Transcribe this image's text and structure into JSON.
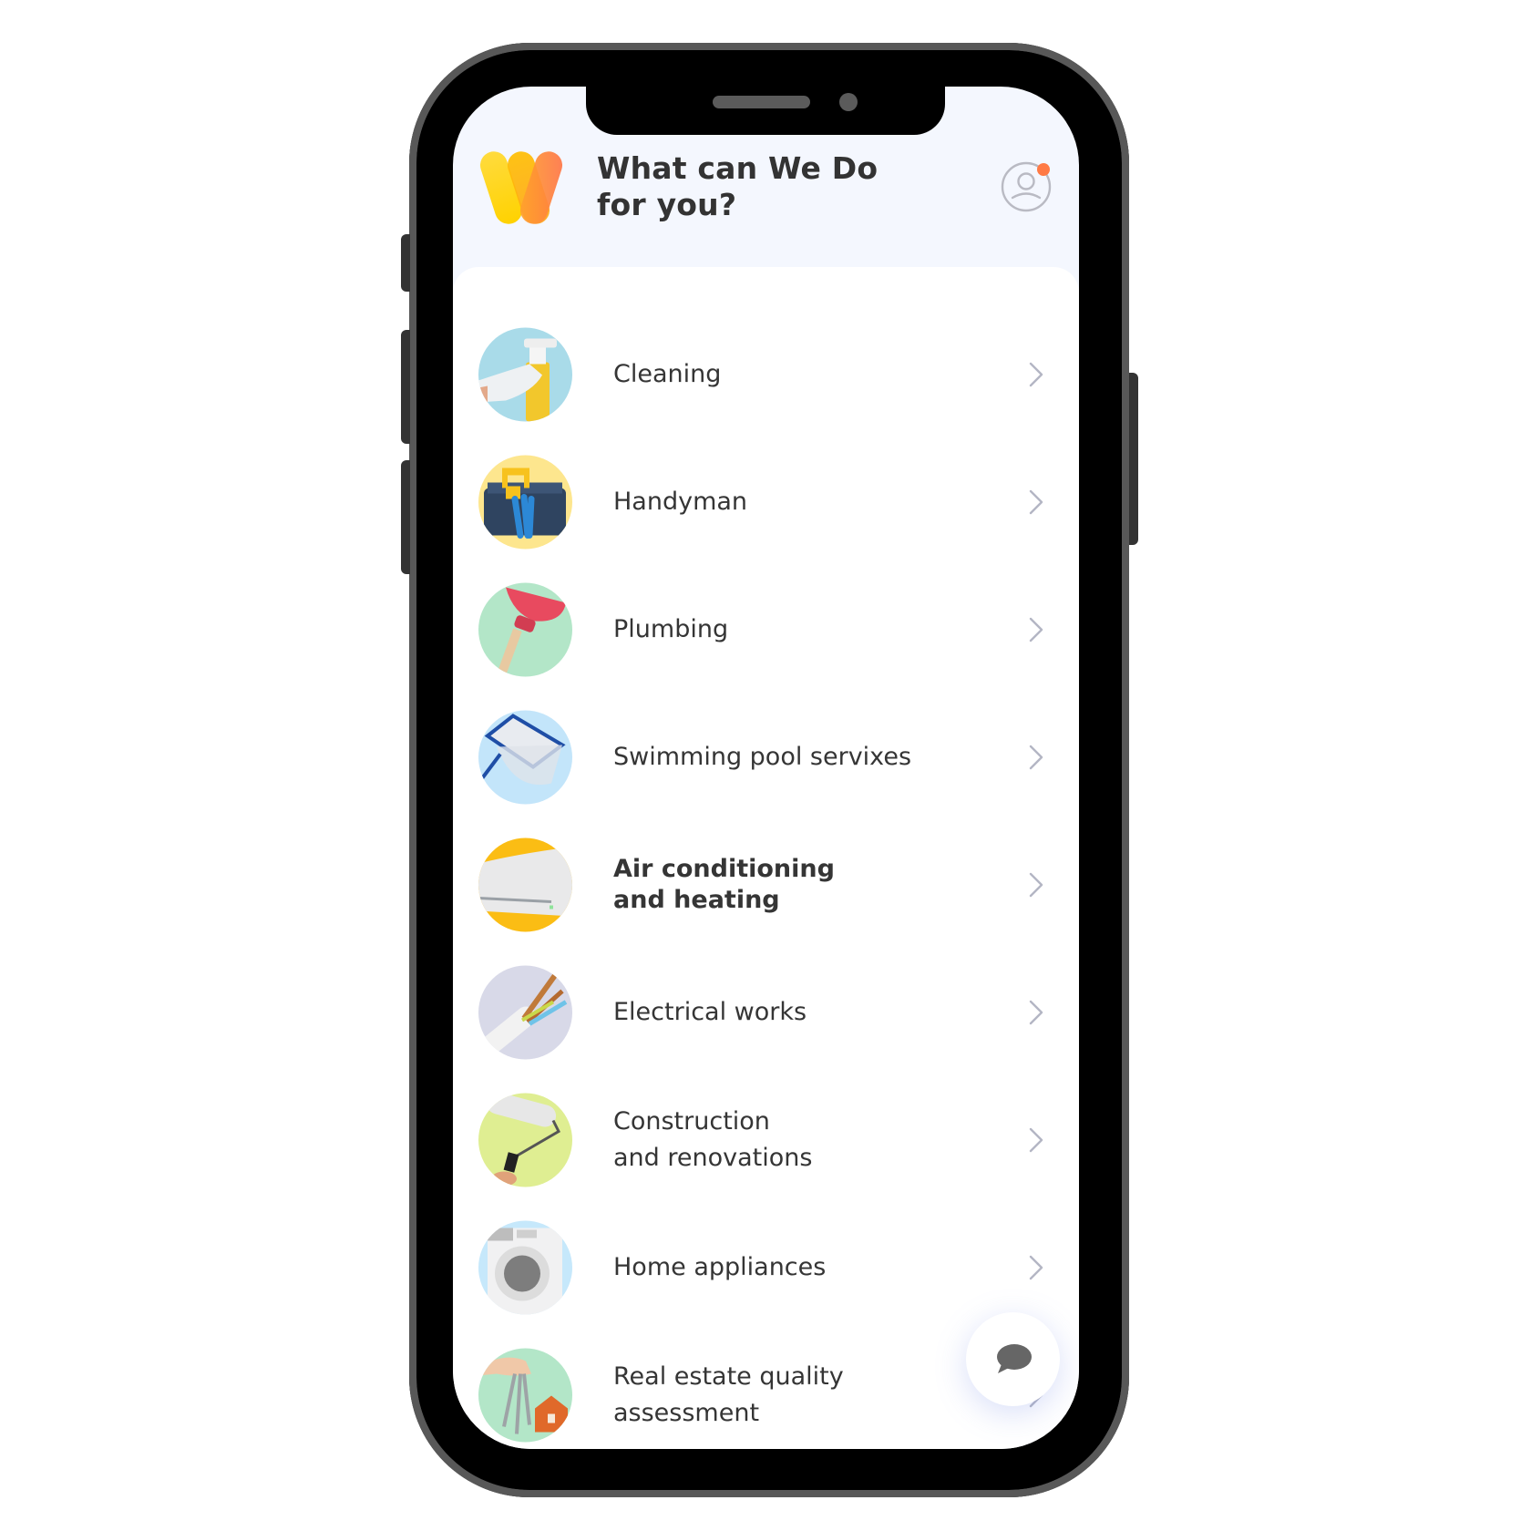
{
  "header": {
    "title_line1": "What can We Do",
    "title_line2": "for you?",
    "logo_icon": "brand-w-logo",
    "profile_icon": "user-profile-icon",
    "notification_dot_color": "#ff7a45"
  },
  "services": [
    {
      "label": "Cleaning",
      "icon": "spray-bottle-icon",
      "bg": "#a9dbe9",
      "bold": false
    },
    {
      "label": "Handyman",
      "icon": "toolbox-icon",
      "bg": "#fde68e",
      "bold": false
    },
    {
      "label": "Plumbing",
      "icon": "plunger-icon",
      "bg": "#b3e6c8",
      "bold": false
    },
    {
      "label": "Swimming pool servixes",
      "icon": "pool-net-icon",
      "bg": "#c3e5fa",
      "bold": false
    },
    {
      "label": "Air conditioning\nand heating",
      "icon": "air-conditioner-icon",
      "bg": "#fbbd14",
      "bold": true
    },
    {
      "label": "Electrical works",
      "icon": "electric-wires-icon",
      "bg": "#d8d9e8",
      "bold": false
    },
    {
      "label": "Construction\nand renovations",
      "icon": "paint-roller-icon",
      "bg": "#dfee92",
      "bold": false
    },
    {
      "label": "Home appliances",
      "icon": "washing-machine-icon",
      "bg": "#c6e8fb",
      "bold": false
    },
    {
      "label": "Real estate quality\nassessment",
      "icon": "house-keys-icon",
      "bg": "#b3e6c8",
      "bold": false
    }
  ],
  "fab": {
    "icon": "chat-bubble-icon"
  },
  "colors": {
    "screen_bg": "#f4f7fe",
    "card_bg": "#ffffff",
    "text": "#353535",
    "chevron": "#b4b6c4",
    "logo_yellow": "#ffd21f",
    "logo_orange": "#ff7a4a"
  }
}
